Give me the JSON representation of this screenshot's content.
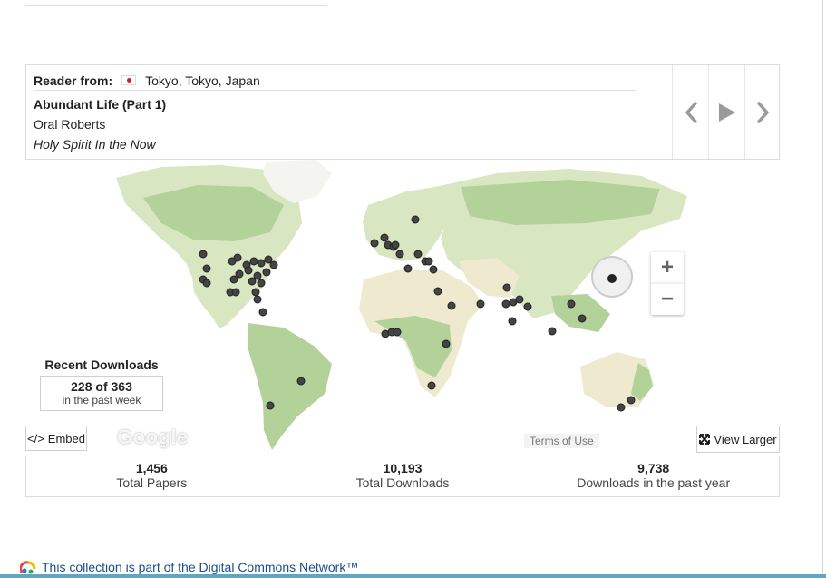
{
  "reader": {
    "label": "Reader from:",
    "flag_icon": "japan-flag-icon",
    "location": "Tokyo, Tokyo, Japan",
    "paper_title": "Abundant Life (Part 1)",
    "author": "Oral Roberts",
    "publication": "Holy Spirit In the Now"
  },
  "controls": {
    "zoom_in": "+",
    "zoom_out": "−",
    "embed_label": "Embed",
    "view_larger_label": "View Larger",
    "terms_label": "Terms of Use",
    "google_label": "Google"
  },
  "recent": {
    "title": "Recent Downloads",
    "count": "228 of 363",
    "period": "in the past week"
  },
  "stats": [
    {
      "value": "1,456",
      "label": "Total Papers"
    },
    {
      "value": "10,193",
      "label": "Total Downloads"
    },
    {
      "value": "9,738",
      "label": "Downloads in the past year"
    }
  ],
  "footer": {
    "network_text": "This collection is part of the Digital Commons Network™"
  },
  "colors": {
    "land": "#d9e6c2",
    "forest": "#b3d29a",
    "desert": "#efe9cf",
    "ice": "#f4f4f0",
    "marker": "#3d3d3d"
  }
}
